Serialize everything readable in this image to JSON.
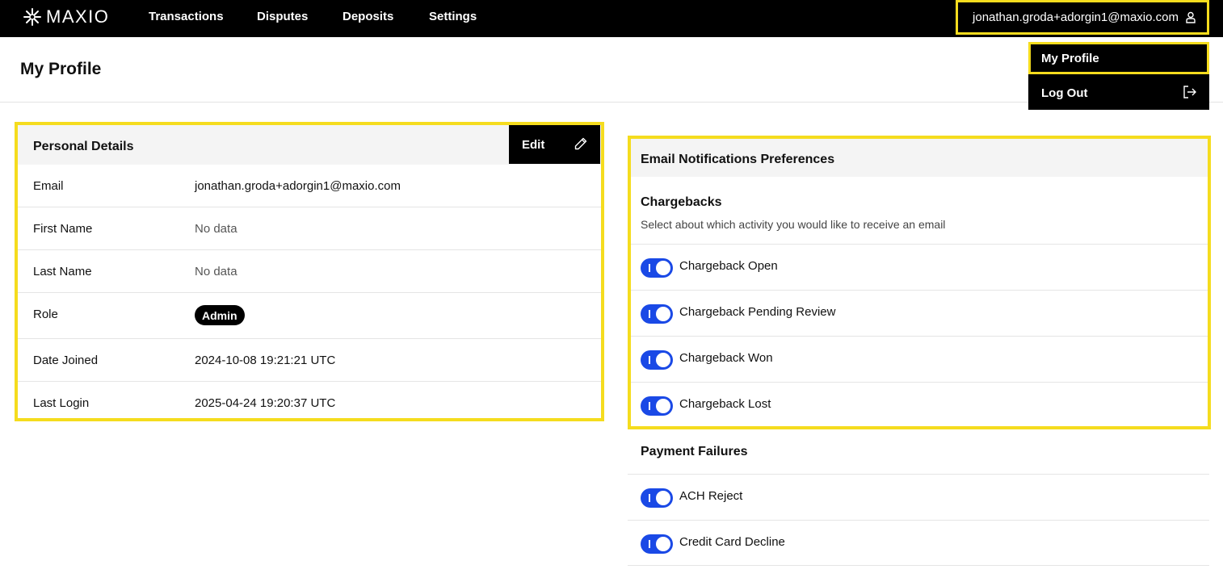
{
  "header": {
    "logo_text": "MAXIO",
    "nav": [
      "Transactions",
      "Disputes",
      "Deposits",
      "Settings"
    ],
    "user_email": "jonathan.groda+adorgin1@maxio.com"
  },
  "dropdown": {
    "my_profile": "My Profile",
    "log_out": "Log Out"
  },
  "page": {
    "title": "My Profile"
  },
  "personal_details": {
    "title": "Personal Details",
    "edit_label": "Edit",
    "rows": [
      {
        "label": "Email",
        "value": "jonathan.groda+adorgin1@maxio.com"
      },
      {
        "label": "First Name",
        "value": "No data"
      },
      {
        "label": "Last Name",
        "value": "No data"
      },
      {
        "label": "Role",
        "value": "Admin"
      },
      {
        "label": "Date Joined",
        "value": "2024-10-08 19:21:21 UTC"
      },
      {
        "label": "Last Login",
        "value": "2025-04-24 19:20:37 UTC"
      }
    ]
  },
  "email_notifications": {
    "title": "Email Notifications Preferences",
    "chargebacks": {
      "title": "Chargebacks",
      "subtitle": "Select about which activity you would like to receive an email",
      "items": [
        {
          "label": "Chargeback Open",
          "enabled": true
        },
        {
          "label": "Chargeback Pending Review",
          "enabled": true
        },
        {
          "label": "Chargeback Won",
          "enabled": true
        },
        {
          "label": "Chargeback Lost",
          "enabled": true
        }
      ]
    },
    "payment_failures": {
      "title": "Payment Failures",
      "items": [
        {
          "label": "ACH Reject",
          "enabled": true
        },
        {
          "label": "Credit Card Decline",
          "enabled": true
        }
      ]
    }
  },
  "colors": {
    "highlight": "#f5dc1e",
    "toggle_on": "#1a49e6",
    "nav_bg": "#000000"
  }
}
